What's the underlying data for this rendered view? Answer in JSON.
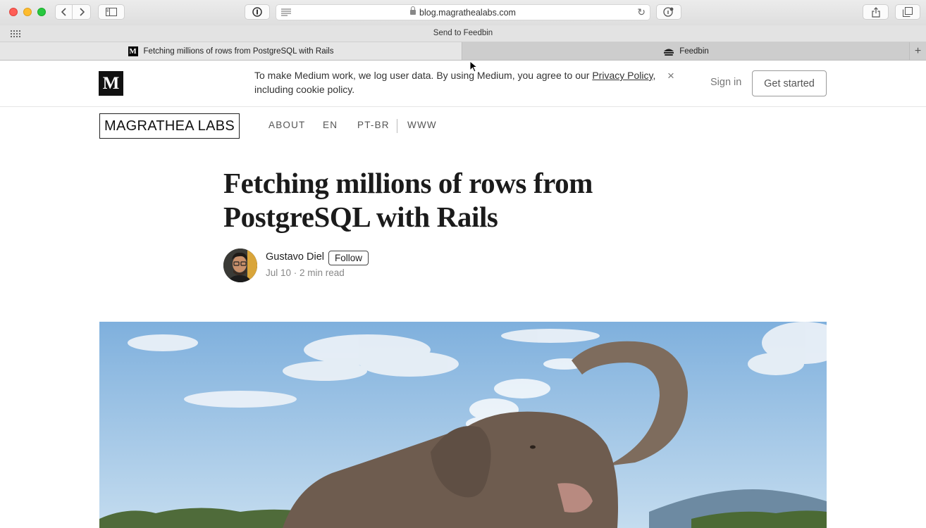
{
  "browser": {
    "url": "blog.magrathealabs.com",
    "favorites_item": "Send to Feedbin",
    "tabs": [
      {
        "title": "Fetching millions of rows from PostgreSQL with Rails",
        "active": true
      },
      {
        "title": "Feedbin",
        "active": false
      }
    ]
  },
  "medium": {
    "logo_letter": "M",
    "notice_text": "To make Medium work, we log user data. By using Medium, you agree to our ",
    "notice_link": "Privacy Policy",
    "notice_tail": ",",
    "notice_line2": "including cookie policy.",
    "close_glyph": "×",
    "sign_in": "Sign in",
    "get_started": "Get started"
  },
  "publication": {
    "name": "MAGRATHEA LABS",
    "nav": [
      "ABOUT",
      "EN",
      "PT-BR",
      "WWW"
    ]
  },
  "article": {
    "title_line1": "Fetching millions of rows from",
    "title_line2": "PostgreSQL with Rails",
    "author": "Gustavo Diel",
    "follow": "Follow",
    "meta": "Jul 10 · 2 min read"
  },
  "colors": {
    "close": "#fe5f57",
    "minimize": "#febc2e",
    "maximize": "#28c840",
    "sky": "#a9c9e6"
  }
}
